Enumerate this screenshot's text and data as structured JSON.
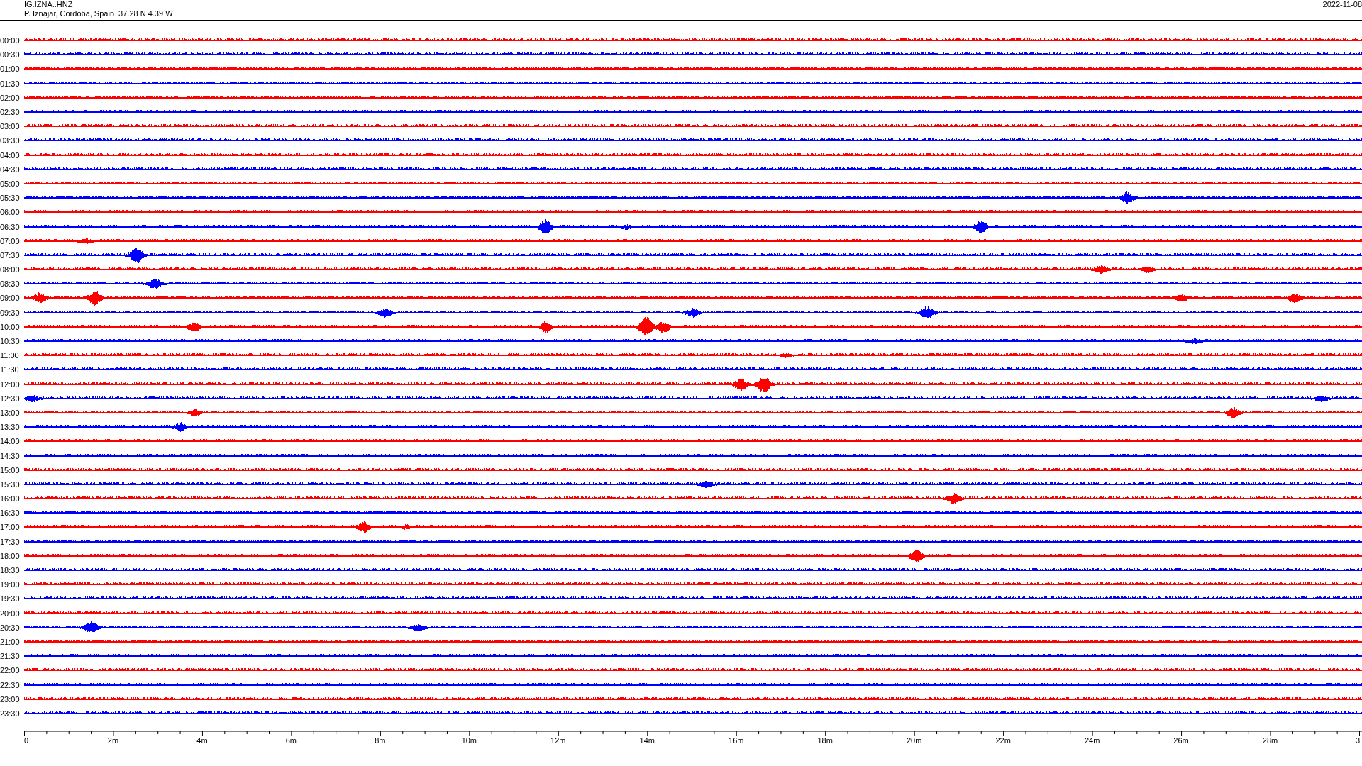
{
  "header": {
    "station": "IG.IZNA..HNZ",
    "location": "P. Iznajar, Cordoba, Spain  37.28 N 4.39 W",
    "date": "2022-11-08"
  },
  "rows": [
    {
      "time": "00:00",
      "color": "#ff0000"
    },
    {
      "time": "00:30",
      "color": "#0000ff"
    },
    {
      "time": "01:00",
      "color": "#ff0000"
    },
    {
      "time": "01:30",
      "color": "#0000ff"
    },
    {
      "time": "02:00",
      "color": "#ff0000"
    },
    {
      "time": "02:30",
      "color": "#0000ff"
    },
    {
      "time": "03:00",
      "color": "#ff0000"
    },
    {
      "time": "03:30",
      "color": "#0000ff"
    },
    {
      "time": "04:00",
      "color": "#ff0000"
    },
    {
      "time": "04:30",
      "color": "#0000ff"
    },
    {
      "time": "05:00",
      "color": "#ff0000"
    },
    {
      "time": "05:30",
      "color": "#0000ff"
    },
    {
      "time": "06:00",
      "color": "#ff0000"
    },
    {
      "time": "06:30",
      "color": "#0000ff"
    },
    {
      "time": "07:00",
      "color": "#ff0000"
    },
    {
      "time": "07:30",
      "color": "#0000ff"
    },
    {
      "time": "08:00",
      "color": "#ff0000"
    },
    {
      "time": "08:30",
      "color": "#0000ff"
    },
    {
      "time": "09:00",
      "color": "#ff0000"
    },
    {
      "time": "09:30",
      "color": "#0000ff"
    },
    {
      "time": "10:00",
      "color": "#ff0000"
    },
    {
      "time": "10:30",
      "color": "#0000ff"
    },
    {
      "time": "11:00",
      "color": "#ff0000"
    },
    {
      "time": "11:30",
      "color": "#0000ff"
    },
    {
      "time": "12:00",
      "color": "#ff0000"
    },
    {
      "time": "12:30",
      "color": "#0000ff"
    },
    {
      "time": "13:00",
      "color": "#ff0000"
    },
    {
      "time": "13:30",
      "color": "#0000ff"
    },
    {
      "time": "14:00",
      "color": "#ff0000"
    },
    {
      "time": "14:30",
      "color": "#0000ff"
    },
    {
      "time": "15:00",
      "color": "#ff0000"
    },
    {
      "time": "15:30",
      "color": "#0000ff"
    },
    {
      "time": "16:00",
      "color": "#ff0000"
    },
    {
      "time": "16:30",
      "color": "#0000ff"
    },
    {
      "time": "17:00",
      "color": "#ff0000"
    },
    {
      "time": "17:30",
      "color": "#0000ff"
    },
    {
      "time": "18:00",
      "color": "#ff0000"
    },
    {
      "time": "18:30",
      "color": "#0000ff"
    },
    {
      "time": "19:00",
      "color": "#ff0000"
    },
    {
      "time": "19:30",
      "color": "#0000ff"
    },
    {
      "time": "20:00",
      "color": "#ff0000"
    },
    {
      "time": "20:30",
      "color": "#0000ff"
    },
    {
      "time": "21:00",
      "color": "#ff0000"
    },
    {
      "time": "21:30",
      "color": "#0000ff"
    },
    {
      "time": "22:00",
      "color": "#ff0000"
    },
    {
      "time": "22:30",
      "color": "#0000ff"
    },
    {
      "time": "23:00",
      "color": "#ff0000"
    },
    {
      "time": "23:30",
      "color": "#0000ff"
    }
  ],
  "x_axis": {
    "labels": [
      "0",
      "2m",
      "4m",
      "6m",
      "8m",
      "10m",
      "12m",
      "14m",
      "16m",
      "18m",
      "20m",
      "22m",
      "24m",
      "26m",
      "28m",
      "3"
    ]
  }
}
